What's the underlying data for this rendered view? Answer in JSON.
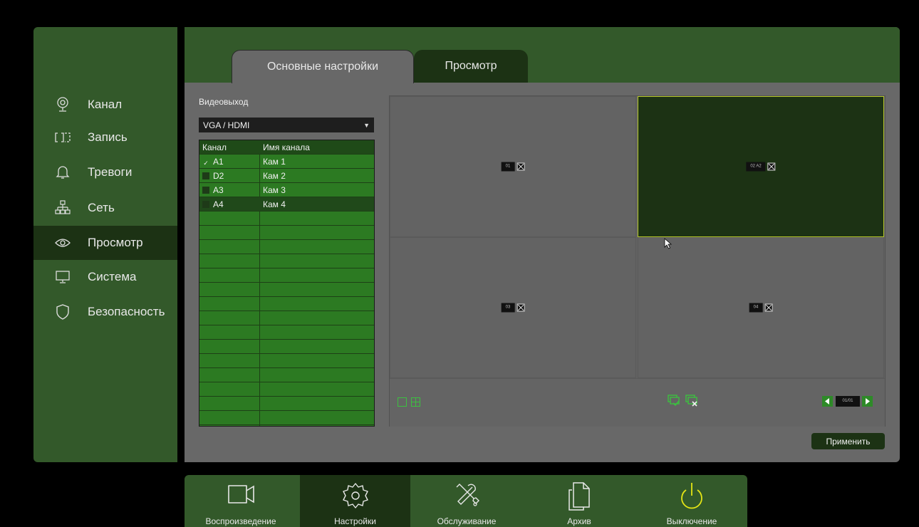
{
  "sidebar": {
    "items": [
      {
        "label": "Канал",
        "icon": "camera-icon"
      },
      {
        "label": "Запись",
        "icon": "record-icon"
      },
      {
        "label": "Тревоги",
        "icon": "bell-icon"
      },
      {
        "label": "Сеть",
        "icon": "network-icon"
      },
      {
        "label": "Просмотр",
        "icon": "eye-icon",
        "active": true
      },
      {
        "label": "Система",
        "icon": "monitor-icon"
      },
      {
        "label": "Безопасность",
        "icon": "shield-icon"
      }
    ]
  },
  "tabs": [
    {
      "label": "Основные настройки"
    },
    {
      "label": "Просмотр",
      "active": true
    }
  ],
  "videoout": {
    "label": "Видеовыход",
    "value": "VGA / HDMI"
  },
  "channel_table": {
    "headers": [
      "Канал",
      "Имя канала"
    ],
    "rows": [
      {
        "channel": "A1",
        "name": "Кам 1",
        "checked": true
      },
      {
        "channel": "D2",
        "name": "Кам 2",
        "checked": false
      },
      {
        "channel": "A3",
        "name": "Кам 3",
        "checked": false
      },
      {
        "channel": "A4",
        "name": "Кам 4",
        "checked": false,
        "selected": true
      }
    ]
  },
  "preview": {
    "cells": [
      {
        "num": "01"
      },
      {
        "num": "02 A2",
        "selected": true
      },
      {
        "num": "03"
      },
      {
        "num": "04"
      }
    ],
    "page_indicator": "01/01"
  },
  "apply_label": "Применить",
  "dock": {
    "items": [
      {
        "label": "Воспроизведение",
        "icon": "video-camera-icon"
      },
      {
        "label": "Настройки",
        "icon": "gear-icon",
        "active": true
      },
      {
        "label": "Обслуживание",
        "icon": "tools-icon"
      },
      {
        "label": "Архив",
        "icon": "copy-icon"
      },
      {
        "label": "Выключение",
        "icon": "power-icon"
      }
    ]
  },
  "colors": {
    "panel_green": "#33592a",
    "active_green": "#1c3214",
    "table_green": "#2c7a22",
    "selection_yellow": "#b8c928",
    "power_yellow": "#e5e515"
  }
}
